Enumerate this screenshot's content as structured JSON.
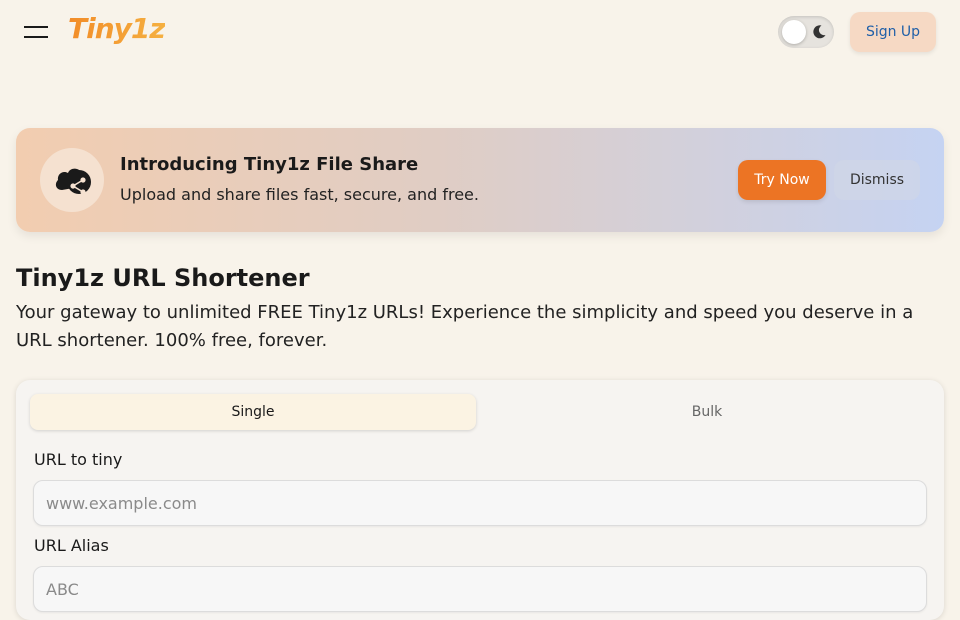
{
  "header": {
    "logo": "Tiny1z",
    "signup_label": "Sign Up"
  },
  "banner": {
    "title": "Introducing Tiny1z File Share",
    "subtitle": "Upload and share files fast, secure, and free.",
    "try_label": "Try Now",
    "dismiss_label": "Dismiss"
  },
  "main": {
    "title": "Tiny1z URL Shortener",
    "description": "Your gateway to unlimited FREE Tiny1z URLs! Experience the simplicity and speed you deserve in a URL shortener. 100% free, forever."
  },
  "form": {
    "tabs": [
      {
        "label": "Single"
      },
      {
        "label": "Bulk"
      }
    ],
    "url_label": "URL to tiny",
    "url_placeholder": "www.example.com",
    "alias_label": "URL Alias",
    "alias_placeholder": "ABC"
  },
  "colors": {
    "accent": "#ec7424",
    "background": "#f8f3ea"
  }
}
